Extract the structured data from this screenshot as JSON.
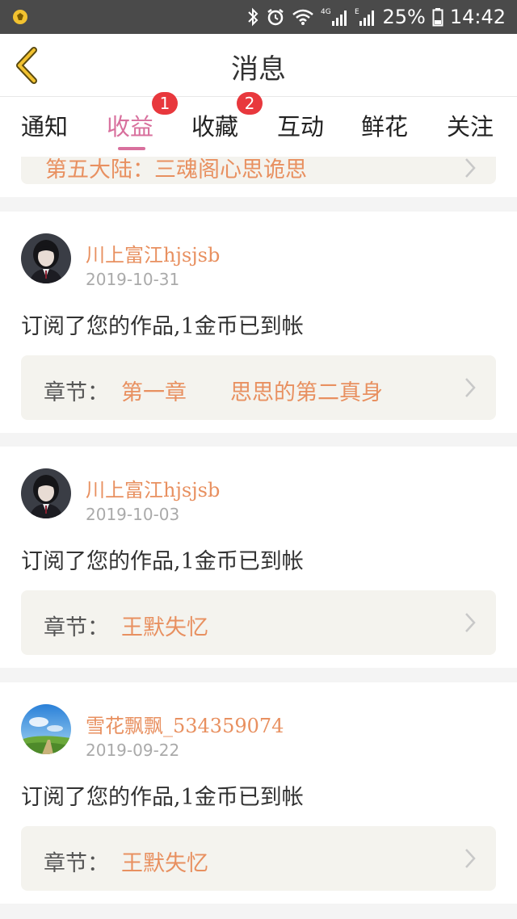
{
  "status_bar": {
    "battery": "25%",
    "time": "14:42",
    "network": "4G"
  },
  "header": {
    "title": "消息"
  },
  "tabs": [
    {
      "label": "通知",
      "active": false
    },
    {
      "label": "收益",
      "active": true,
      "badge": "1"
    },
    {
      "label": "收藏",
      "active": false,
      "badge": "2"
    },
    {
      "label": "互动",
      "active": false
    },
    {
      "label": "鲜花",
      "active": false
    },
    {
      "label": "关注",
      "active": false
    }
  ],
  "colors": {
    "accent_pink": "#d8709d",
    "orange": "#e89060",
    "badge_red": "#e8383d"
  },
  "partial_card": {
    "chapter_value": "第五大陆：三魂阁心思诡思"
  },
  "feed": [
    {
      "name": "川上富江hjsjsb",
      "date": "2019-10-31",
      "message": "订阅了您的作品,1金币已到帐",
      "chapter_label": "章节：",
      "chapter_value": "第一章　　思思的第二真身",
      "avatar": "girl-avatar"
    },
    {
      "name": "川上富江hjsjsb",
      "date": "2019-10-03",
      "message": "订阅了您的作品,1金币已到帐",
      "chapter_label": "章节：",
      "chapter_value": "王默失忆",
      "avatar": "girl-avatar"
    },
    {
      "name": "雪花飘飘_534359074",
      "date": "2019-09-22",
      "message": "订阅了您的作品,1金币已到帐",
      "chapter_label": "章节：",
      "chapter_value": "王默失忆",
      "avatar": "landscape-avatar"
    }
  ]
}
